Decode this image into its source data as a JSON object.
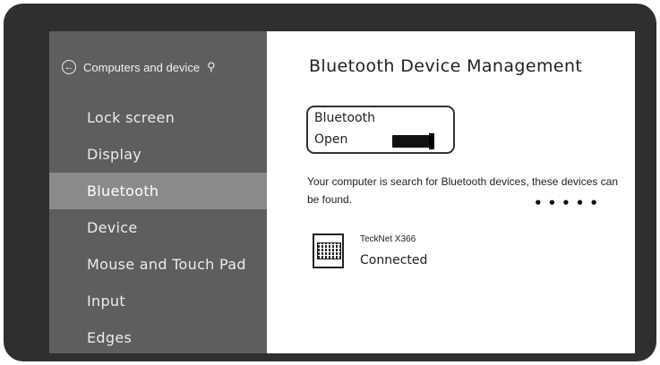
{
  "sidebar": {
    "header": "Computers and device",
    "back_icon": "back-arrow-icon",
    "search_icon": "search-icon",
    "items": [
      {
        "label": "Lock screen",
        "active": false
      },
      {
        "label": "Display",
        "active": false
      },
      {
        "label": "Bluetooth",
        "active": true
      },
      {
        "label": "Device",
        "active": false
      },
      {
        "label": "Mouse and Touch Pad",
        "active": false
      },
      {
        "label": "Input",
        "active": false
      },
      {
        "label": "Edges",
        "active": false
      }
    ]
  },
  "main": {
    "title": "Bluetooth Device Management",
    "bluetooth_toggle": {
      "label": "Bluetooth",
      "state": "Open"
    },
    "info": "Your computer is search for Bluetooth devices, these devices can be found.",
    "progress_dots": "•••••",
    "device": {
      "icon": "keyboard-icon",
      "name": "TeckNet X366",
      "status": "Connected"
    }
  },
  "colors": {
    "bezel": "#2f2f2f",
    "sidebar_bg": "#5e5e5e",
    "sidebar_active": "#8a8a8a",
    "content_bg": "#ffffff"
  }
}
